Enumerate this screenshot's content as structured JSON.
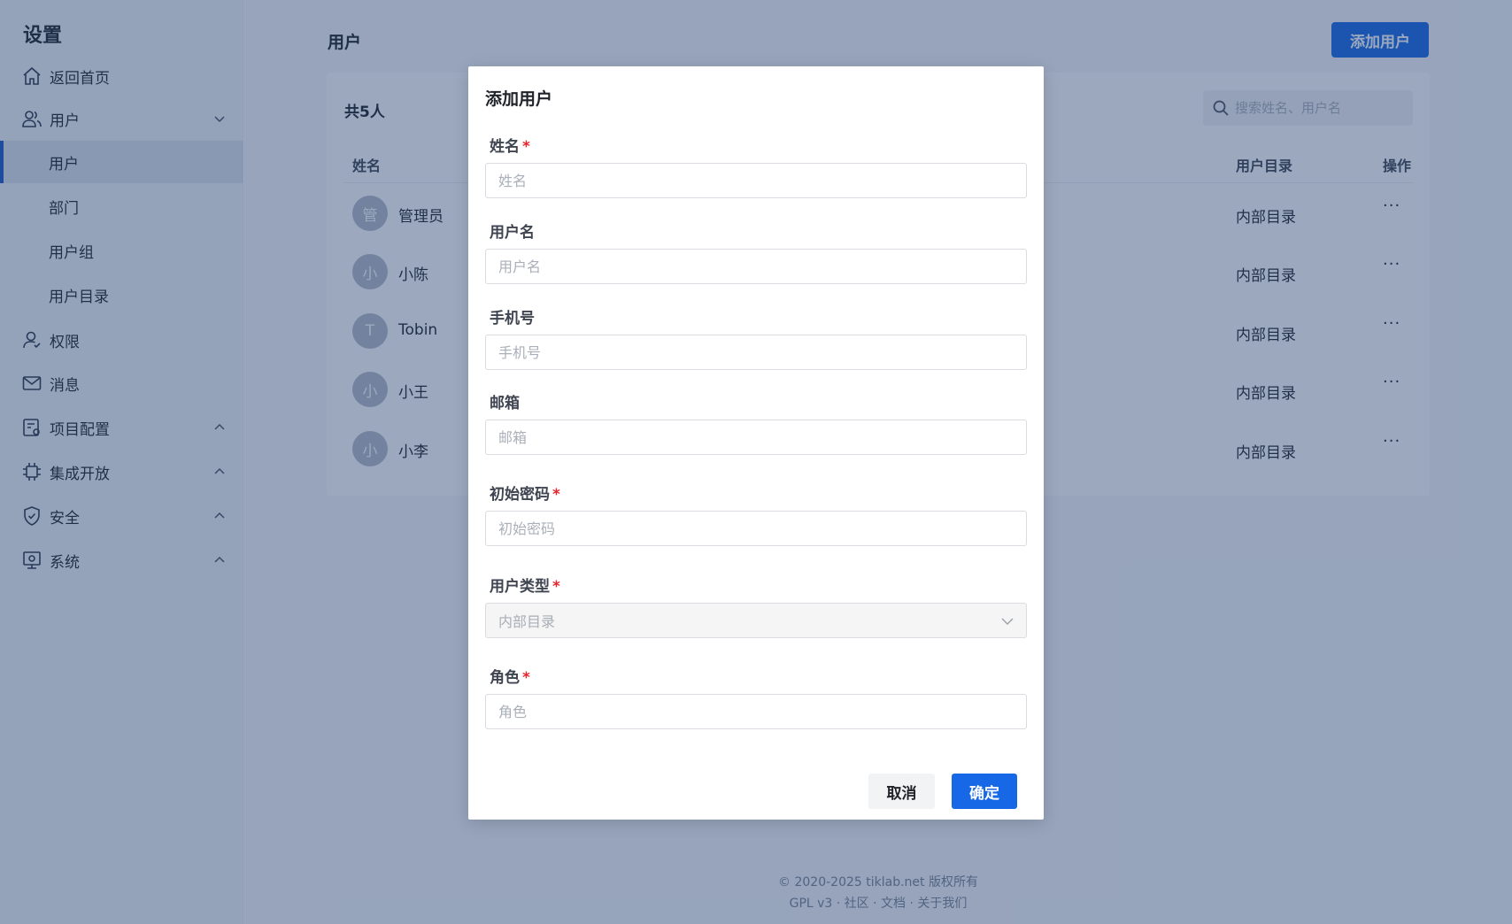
{
  "sidebar": {
    "title": "设置",
    "home": "返回首页",
    "users_group": "用户",
    "sub_users": "用户",
    "sub_dept": "部门",
    "sub_usergroup": "用户组",
    "sub_userdir": "用户目录",
    "permission": "权限",
    "message": "消息",
    "project_config": "项目配置",
    "integration": "集成开放",
    "security": "安全",
    "system": "系统"
  },
  "main": {
    "title": "用户",
    "add_button": "添加用户",
    "count": "共5人",
    "search_placeholder": "搜索姓名、用户名",
    "columns": {
      "name": "姓名",
      "directory": "用户目录",
      "action": "操作"
    },
    "rows": [
      {
        "avatar": "管",
        "name": "管理员",
        "directory": "内部目录",
        "action": "···"
      },
      {
        "avatar": "小",
        "name": "小陈",
        "directory": "内部目录",
        "action": "···"
      },
      {
        "avatar": "T",
        "name": "Tobin",
        "directory": "内部目录",
        "action": "···"
      },
      {
        "avatar": "小",
        "name": "小王",
        "directory": "内部目录",
        "action": "···"
      },
      {
        "avatar": "小",
        "name": "小李",
        "directory": "内部目录",
        "action": "···"
      }
    ]
  },
  "footer": {
    "copyright": "© 2020-2025 tiklab.net 版权所有",
    "links": "GPL v3 · 社区 · 文档 · 关于我们"
  },
  "modal": {
    "title": "添加用户",
    "required_mark": "*",
    "fields": {
      "name": {
        "label": "姓名",
        "placeholder": "姓名"
      },
      "username": {
        "label": "用户名",
        "placeholder": "用户名"
      },
      "phone": {
        "label": "手机号",
        "placeholder": "手机号"
      },
      "email": {
        "label": "邮箱",
        "placeholder": "邮箱"
      },
      "password": {
        "label": "初始密码",
        "placeholder": "初始密码"
      },
      "user_type": {
        "label": "用户类型",
        "value": "内部目录"
      },
      "role": {
        "label": "角色",
        "placeholder": "角色"
      }
    },
    "cancel": "取消",
    "confirm": "确定"
  },
  "colors": {
    "primary": "#1768e6",
    "required": "#e5242b",
    "overlay": "rgba(33,63,110,0.45)"
  }
}
